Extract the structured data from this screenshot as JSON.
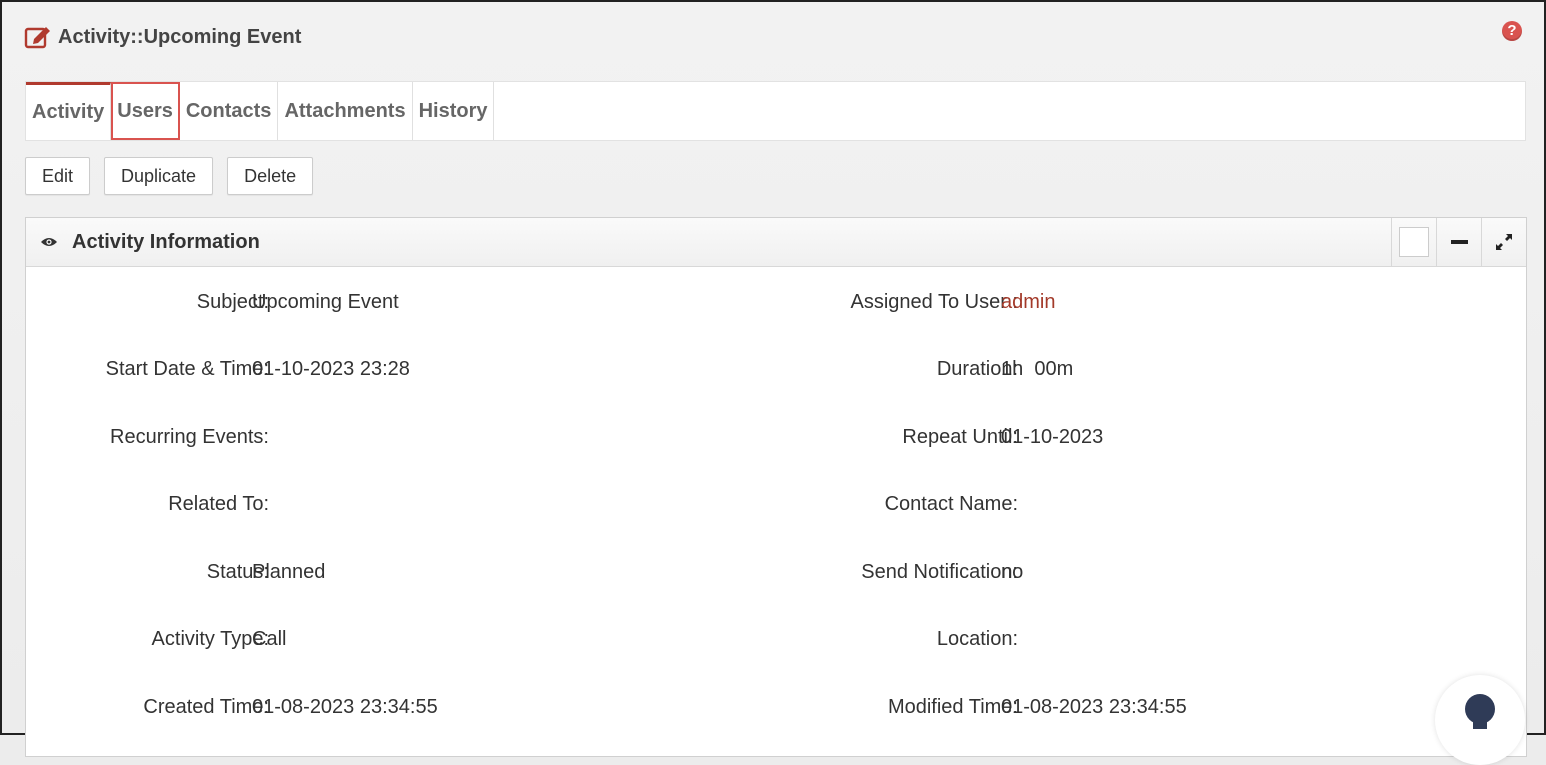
{
  "header": {
    "title": "Activity::Upcoming Event",
    "help": "?"
  },
  "tabs": [
    {
      "label": "Activity",
      "active": true
    },
    {
      "label": "Users",
      "focused": true
    },
    {
      "label": "Contacts"
    },
    {
      "label": "Attachments"
    },
    {
      "label": "History"
    }
  ],
  "actions": {
    "edit": "Edit",
    "duplicate": "Duplicate",
    "delete": "Delete"
  },
  "panel": {
    "title": "Activity Information",
    "fields": {
      "subject": {
        "label": "Subject:",
        "value": "Upcoming Event"
      },
      "assigned": {
        "label": "Assigned To User :",
        "value": "admin"
      },
      "start": {
        "label": "Start Date & Time:",
        "value": "01-10-2023 23:28"
      },
      "duration": {
        "label": "Duration:",
        "value": "1h  00m"
      },
      "recurring": {
        "label": "Recurring Events:",
        "value": ""
      },
      "repeat": {
        "label": "Repeat Until:",
        "value": "01-10-2023"
      },
      "related": {
        "label": "Related To:",
        "value": ""
      },
      "contact": {
        "label": "Contact Name:",
        "value": ""
      },
      "status": {
        "label": "Status:",
        "value": "Planned"
      },
      "notification": {
        "label": "Send Notification:",
        "value": "no"
      },
      "type": {
        "label": "Activity Type:",
        "value": "Call"
      },
      "location": {
        "label": "Location:",
        "value": ""
      },
      "created": {
        "label": "Created Time:",
        "value": "01-08-2023 23:34:55"
      },
      "modified": {
        "label": "Modified Time:",
        "value": "01-08-2023 23:34:55"
      }
    }
  },
  "colors": {
    "accent": "#b03a2e",
    "link": "#a33a2a",
    "help": "#d9534f"
  },
  "icons": [
    "edit-icon",
    "help-icon",
    "eye-icon",
    "minimize-icon",
    "expand-icon",
    "lightbulb-icon"
  ]
}
